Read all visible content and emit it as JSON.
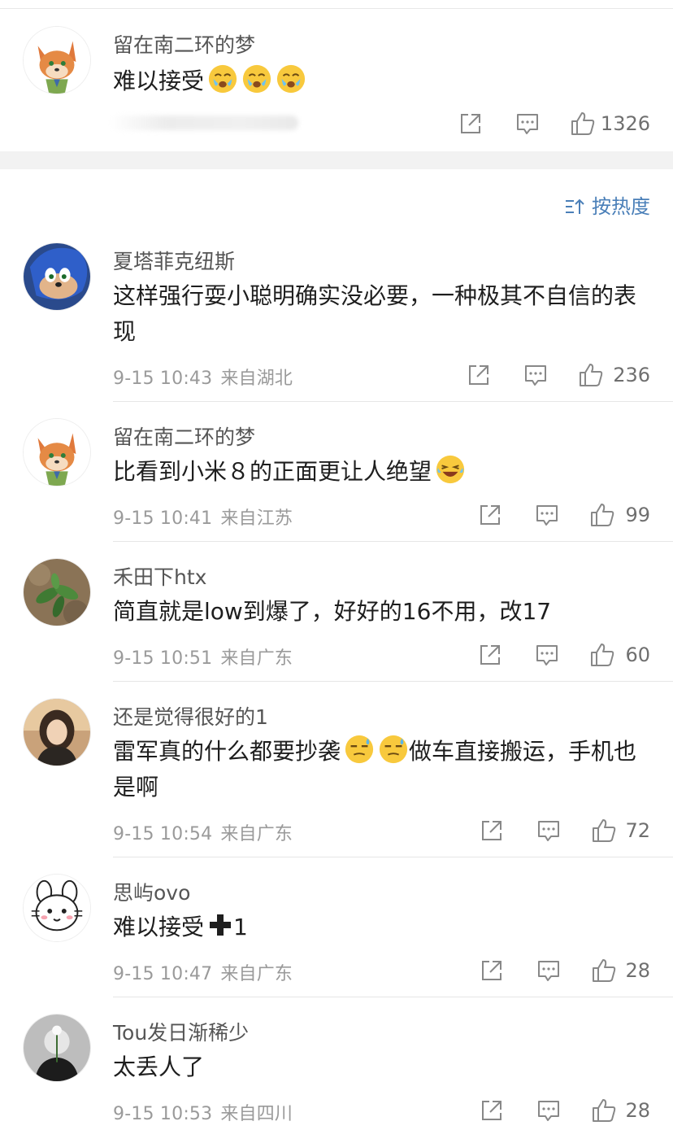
{
  "pinned": {
    "user": "留在南二环的梦",
    "text": "难以接受",
    "emoji": [
      "crying-emoji",
      "crying-emoji",
      "crying-emoji"
    ],
    "likes": "1326"
  },
  "sort": {
    "label": "按热度",
    "icon": "sort-icon"
  },
  "comments": [
    {
      "user": "夏塔菲克纽斯",
      "text": "这样强行耍小聪明确实没必要，一种极其不自信的表现",
      "time": "9-15 10:43",
      "location": "来自湖北",
      "likes": "236"
    },
    {
      "user": "留在南二环的梦",
      "text": "比看到小米８的正面更让人绝望",
      "time": "9-15 10:41",
      "location": "来自江苏",
      "likes": "99",
      "emoji": "laughing-tears-emoji"
    },
    {
      "user": "禾田下htx",
      "text": "简直就是low到爆了，好好的16不用，改17",
      "time": "9-15 10:51",
      "location": "来自广东",
      "likes": "60"
    },
    {
      "user": "还是觉得很好的1",
      "text_a": "雷军真的什么都要抄袭",
      "text_b": "做车直接搬运，手机也是啊",
      "time": "9-15 10:54",
      "location": "来自广东",
      "likes": "72",
      "emoji": "sweat-emoji"
    },
    {
      "user": "思屿ovo",
      "text": "难以接受",
      "text_suffix": "1",
      "time": "9-15 10:47",
      "location": "来自广东",
      "likes": "28",
      "emoji": "plus-emoji"
    },
    {
      "user": "Tou发日渐稀少",
      "text": "太丢人了",
      "time": "9-15 10:53",
      "location": "来自四川",
      "likes": "28"
    }
  ],
  "icons": {
    "share": "share-icon",
    "comment": "comment-icon",
    "like": "thumbs-up-icon"
  },
  "colors": {
    "link": "#4a7fb8",
    "meta": "#9a9a9a",
    "band": "#f2f2f2"
  }
}
